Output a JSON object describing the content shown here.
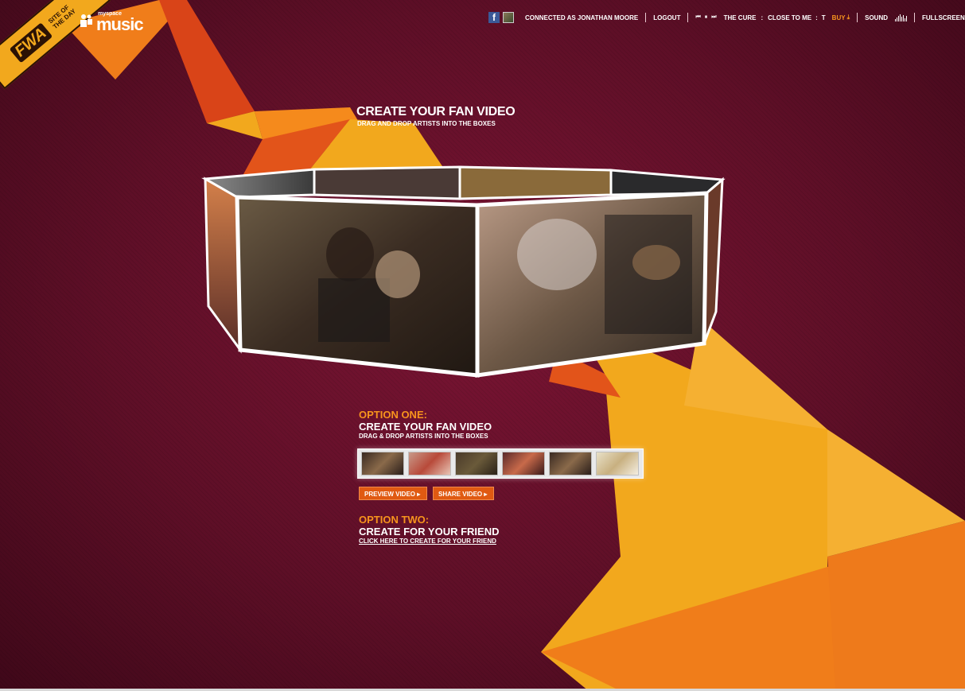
{
  "badge": {
    "logo_text": "FWA",
    "label": "SITE OF THE DAY"
  },
  "brand": {
    "small": "myspace",
    "big": "music"
  },
  "topbar": {
    "facebook_glyph": "f",
    "connected": "CONNECTED AS JONATHAN MOORE",
    "logout": "LOGOUT",
    "prev_glyph": "⏮",
    "pause_glyph": "⏸",
    "next_glyph": "⏭",
    "artist": "THE CURE",
    "colon1": ":",
    "track": "CLOSE TO ME",
    "colon2": ":",
    "truncated": "T",
    "buy": "BUY",
    "buy_icon": "download-icon",
    "sound": "SOUND",
    "fullscreen": "FULLSCREEN"
  },
  "heading": {
    "title": "CREATE YOUR FAN VIDEO",
    "subtitle": "DRAG AND DROP ARTISTS INTO THE BOXES"
  },
  "option_one": {
    "label": "OPTION ONE:",
    "title": "CREATE YOUR FAN VIDEO",
    "subtitle": "DRAG & DROP ARTISTS INTO THE BOXES",
    "thumbnails": [
      "artist-1",
      "artist-2",
      "artist-3",
      "artist-4",
      "artist-5",
      "artist-6"
    ],
    "preview_button": "PREVIEW VIDEO",
    "share_button": "SHARE VIDEO"
  },
  "option_two": {
    "label": "OPTION TWO:",
    "title": "CREATE FOR YOUR FRIEND",
    "link": "CLICK HERE TO CREATE FOR YOUR FRIEND"
  },
  "colors": {
    "background": "#5e0f27",
    "accent_orange": "#f7941d",
    "accent_yellow": "#f2a81d",
    "button": "#e05a12"
  }
}
